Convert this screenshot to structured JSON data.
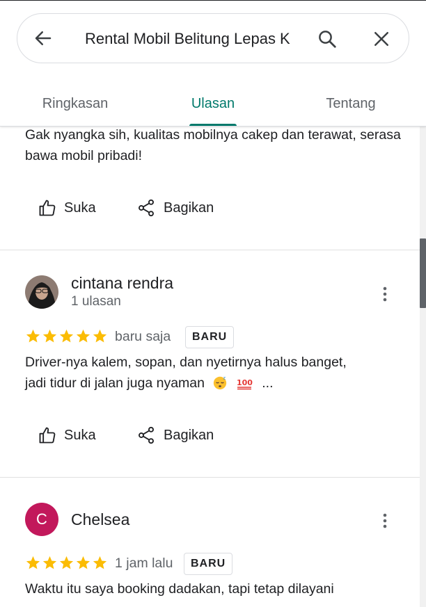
{
  "search": {
    "query": "Rental Mobil Belitung Lepas K"
  },
  "tabs": [
    {
      "label": "Ringkasan",
      "active": false
    },
    {
      "label": "Ulasan",
      "active": true
    },
    {
      "label": "Tentang",
      "active": false
    }
  ],
  "actions": {
    "like_label": "Suka",
    "share_label": "Bagikan"
  },
  "reviews": [
    {
      "text": "Gak nyangka sih, kualitas mobilnya cakep dan terawat, serasa bawa mobil pribadi!"
    },
    {
      "name": "cintana rendra",
      "meta": "1 ulasan",
      "rating": 5,
      "time": "baru saja",
      "badge": "BARU",
      "text_line1": "Driver-nya kalem, sopan, dan nyetirnya halus banget,",
      "text_line2": "jadi tidur di jalan juga nyaman",
      "ellipsis": "..."
    },
    {
      "name": "Chelsea",
      "avatar_letter": "C",
      "rating": 5,
      "time": "1 jam lalu",
      "badge": "BARU",
      "text_line1": "Waktu itu saya booking dadakan, tapi tetap dilayani"
    }
  ],
  "colors": {
    "accent": "#00796b",
    "star": "#fbbc04",
    "avatar_chelsea": "#c2185b"
  }
}
